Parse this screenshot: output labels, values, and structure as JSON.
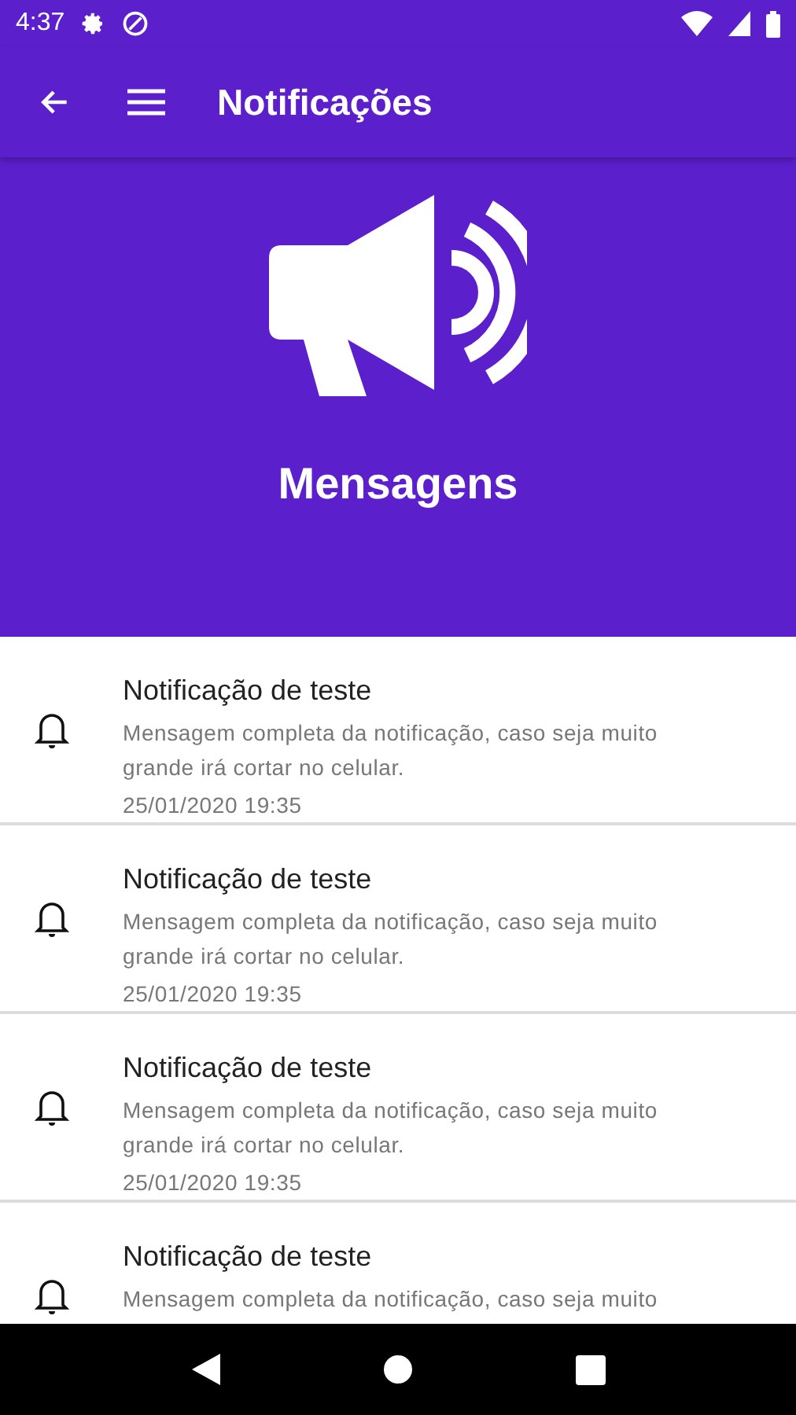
{
  "status_bar": {
    "time": "4:37"
  },
  "toolbar": {
    "title": "Notificações"
  },
  "header": {
    "title": "Mensagens"
  },
  "notifications": [
    {
      "title": "Notificação de teste",
      "message_lines": [
        "Mensagem completa da notificação, caso seja muito",
        "grande irá cortar no celular."
      ],
      "date": "25/01/2020 19:35"
    },
    {
      "title": "Notificação de teste",
      "message_lines": [
        "Mensagem completa da notificação, caso seja muito",
        "grande irá cortar no celular."
      ],
      "date": "25/01/2020 19:35"
    },
    {
      "title": "Notificação de teste",
      "message_lines": [
        "Mensagem completa da notificação, caso seja muito",
        "grande irá cortar no celular."
      ],
      "date": "25/01/2020 19:35"
    },
    {
      "title": "Notificação de teste",
      "message_lines": [
        "Mensagem completa da notificação, caso seja muito"
      ]
    }
  ]
}
